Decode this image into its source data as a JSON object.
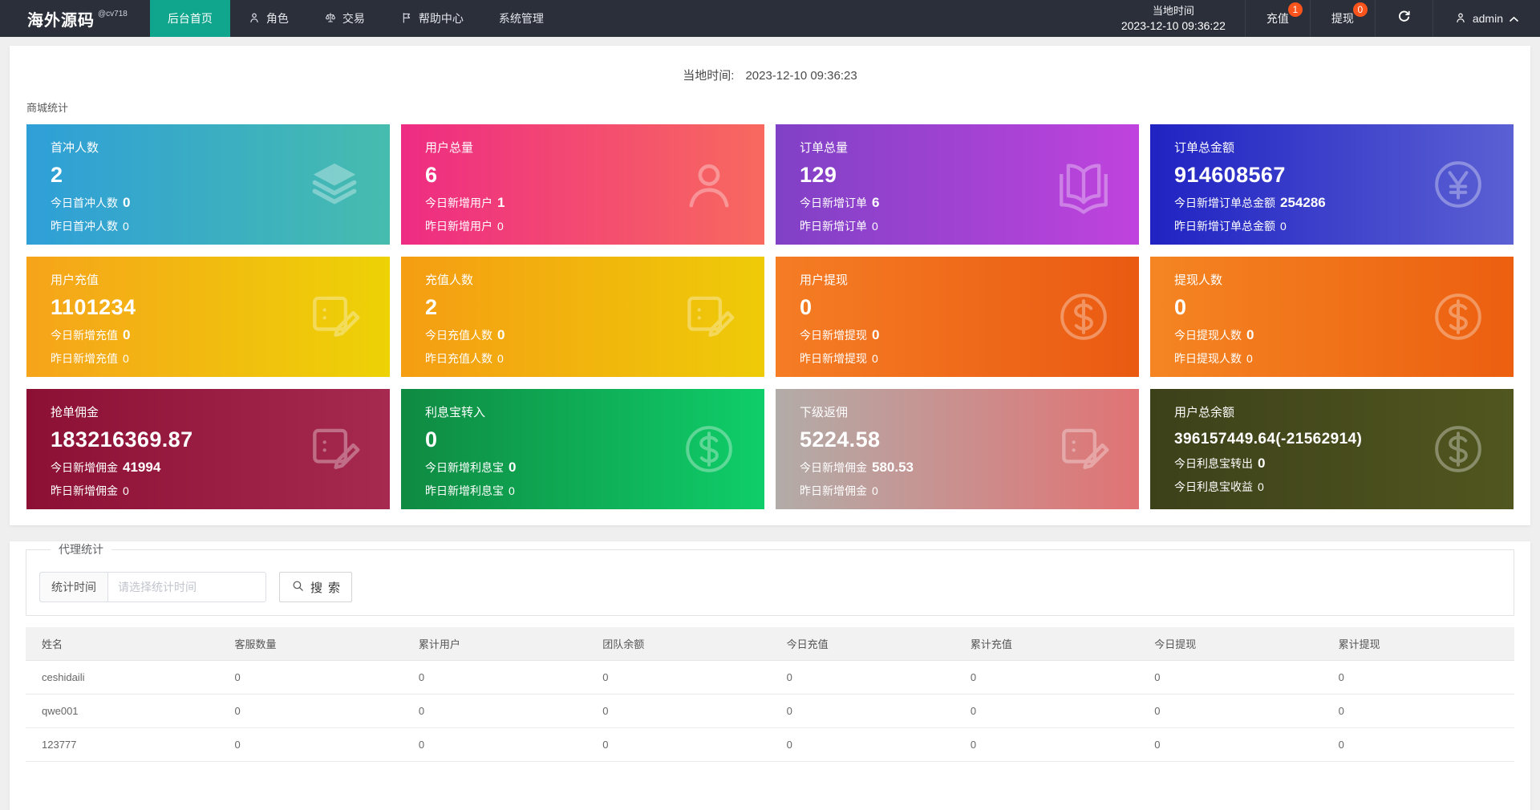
{
  "navbar": {
    "brand": "海外源码",
    "brand_sub": "@cv718",
    "bg_color": "#2b2f3a",
    "active_color": "#10a58d",
    "badge_color": "#fa541c",
    "menu": [
      {
        "label": "后台首页",
        "icon": null,
        "active": true
      },
      {
        "label": "角色",
        "icon": "user-icon",
        "active": false
      },
      {
        "label": "交易",
        "icon": "scales-icon",
        "active": false
      },
      {
        "label": "帮助中心",
        "icon": "flag-icon",
        "active": false
      },
      {
        "label": "系统管理",
        "icon": null,
        "active": false
      }
    ],
    "local_time_label": "当地时间",
    "local_time_value": "2023-12-10 09:36:22",
    "recharge_label": "充值",
    "recharge_badge": "1",
    "withdraw_label": "提现",
    "withdraw_badge": "0",
    "refresh_icon": "refresh-icon",
    "user_icon": "user-icon",
    "caret_icon": "caret-up-icon",
    "username": "admin"
  },
  "main": {
    "local_time_label": "当地时间:",
    "local_time_value": "2023-12-10 09:36:23",
    "section_title": "商城统计"
  },
  "cards": [
    {
      "title": "首冲人数",
      "value": "2",
      "line1_label": "今日首冲人数",
      "line1_value": "0",
      "line2_label": "昨日首冲人数",
      "line2_value": "0",
      "icon": "layers-icon",
      "gradient": [
        "#2f9fd8",
        "#46bcae"
      ]
    },
    {
      "title": "用户总量",
      "value": "6",
      "line1_label": "今日新增用户",
      "line1_value": "1",
      "line2_label": "昨日新增用户",
      "line2_value": "0",
      "icon": "user-icon",
      "gradient": [
        "#ee2c83",
        "#f8695f"
      ]
    },
    {
      "title": "订单总量",
      "value": "129",
      "line1_label": "今日新增订单",
      "line1_value": "6",
      "line2_label": "昨日新增订单",
      "line2_value": "0",
      "icon": "book-icon",
      "gradient": [
        "#8041c6",
        "#c043de"
      ]
    },
    {
      "title": "订单总金额",
      "value": "914608567",
      "line1_label": "今日新增订单总金额",
      "line1_value": "254286",
      "line2_label": "昨日新增订单总金额",
      "line2_value": "0",
      "icon": "yen-circle-icon",
      "gradient": [
        "#2023c2",
        "#5b60d3"
      ]
    },
    {
      "title": "用户充值",
      "value": "1101234",
      "line1_label": "今日新增充值",
      "line1_value": "0",
      "line2_label": "昨日新增充值",
      "line2_value": "0",
      "icon": "edit-note-icon",
      "gradient": [
        "#f6a41a",
        "#edd206"
      ]
    },
    {
      "title": "充值人数",
      "value": "2",
      "line1_label": "今日充值人数",
      "line1_value": "0",
      "line2_label": "昨日充值人数",
      "line2_value": "0",
      "icon": "edit-note-icon",
      "gradient": [
        "#f59d13",
        "#eecb08"
      ]
    },
    {
      "title": "用户提现",
      "value": "0",
      "line1_label": "今日新增提现",
      "line1_value": "0",
      "line2_label": "昨日新增提现",
      "line2_value": "0",
      "icon": "dollar-circle-icon",
      "gradient": [
        "#f57d24",
        "#ea5a12"
      ]
    },
    {
      "title": "提现人数",
      "value": "0",
      "line1_label": "今日提现人数",
      "line1_value": "0",
      "line2_label": "昨日提现人数",
      "line2_value": "0",
      "icon": "dollar-circle-icon",
      "gradient": [
        "#f58522",
        "#ec5f10"
      ]
    },
    {
      "title": "抢单佣金",
      "value": "183216369.87",
      "line1_label": "今日新增佣金",
      "line1_value": "41994",
      "line2_label": "昨日新增佣金",
      "line2_value": "0",
      "icon": "edit-note-icon",
      "gradient": [
        "#8c1034",
        "#a62a50"
      ]
    },
    {
      "title": "利息宝转入",
      "value": "0",
      "line1_label": "今日新增利息宝",
      "line1_value": "0",
      "line2_label": "昨日新增利息宝",
      "line2_value": "0",
      "icon": "dollar-circle-icon",
      "gradient": [
        "#0f8a42",
        "#0fce69"
      ]
    },
    {
      "title": "下级返佣",
      "value": "5224.58",
      "line1_label": "今日新增佣金",
      "line1_value": "580.53",
      "line2_label": "昨日新增佣金",
      "line2_value": "0",
      "icon": "edit-note-icon",
      "gradient": [
        "#b2aca8",
        "#e17374"
      ]
    },
    {
      "title": "用户总余额",
      "value": "396157449.64(-21562914)",
      "line1_label": "今日利息宝转出",
      "line1_value": "0",
      "line2_label": "今日利息宝收益",
      "line2_value": "0",
      "icon": "dollar-circle-icon",
      "gradient": [
        "#3d411a",
        "#51561f"
      ]
    }
  ],
  "agent_section": {
    "legend": "代理统计",
    "time_label": "统计时间",
    "time_placeholder": "请选择统计时间",
    "search_label": "搜索",
    "search_icon": "search-icon"
  },
  "table": {
    "headers": [
      "姓名",
      "客服数量",
      "累计用户",
      "团队余额",
      "今日充值",
      "累计充值",
      "今日提现",
      "累计提现"
    ],
    "rows": [
      [
        "ceshidaili",
        "0",
        "0",
        "0",
        "0",
        "0",
        "0",
        "0"
      ],
      [
        "qwe001",
        "0",
        "0",
        "0",
        "0",
        "0",
        "0",
        "0"
      ],
      [
        "123777",
        "0",
        "0",
        "0",
        "0",
        "0",
        "0",
        "0"
      ]
    ]
  }
}
